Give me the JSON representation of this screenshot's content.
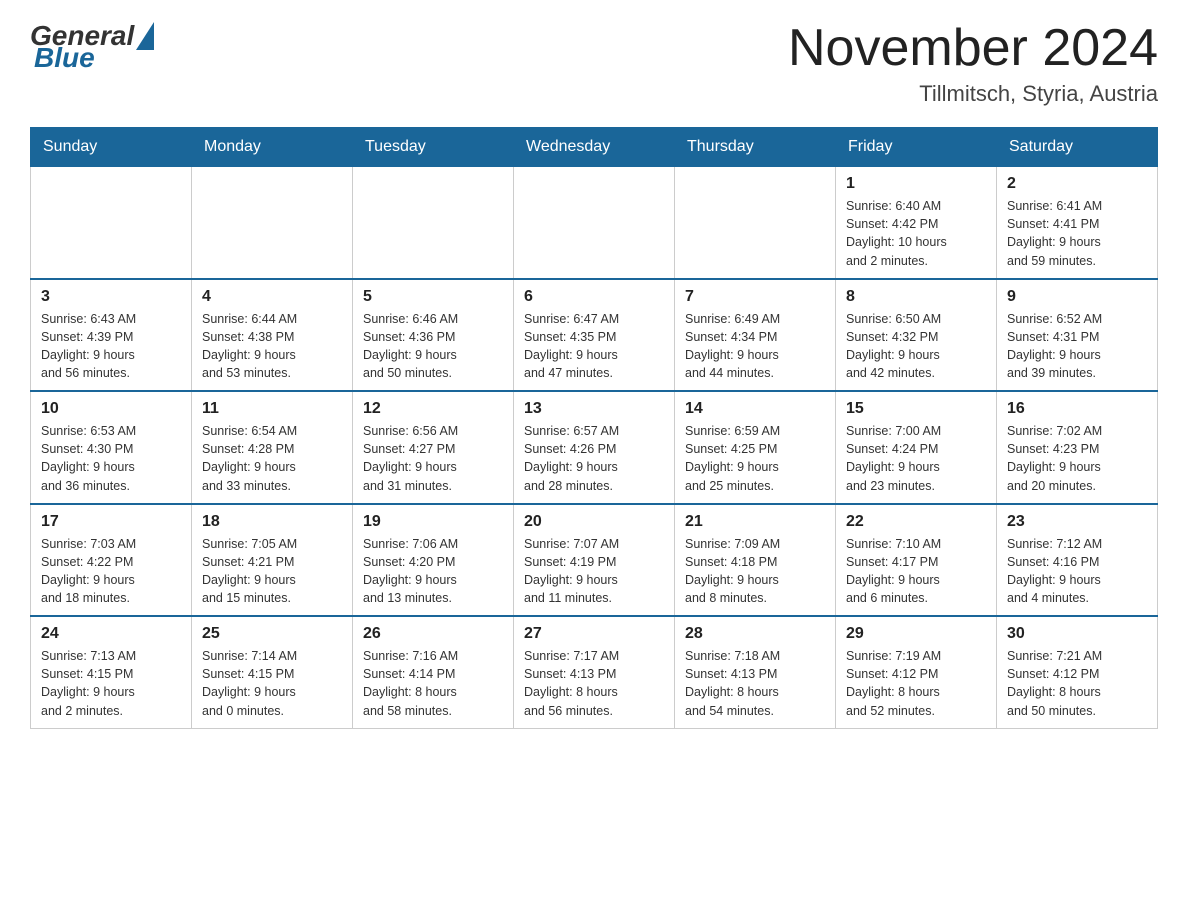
{
  "header": {
    "logo_general": "General",
    "logo_blue": "Blue",
    "month_title": "November 2024",
    "location": "Tillmitsch, Styria, Austria"
  },
  "weekdays": [
    "Sunday",
    "Monday",
    "Tuesday",
    "Wednesday",
    "Thursday",
    "Friday",
    "Saturday"
  ],
  "weeks": [
    [
      {
        "day": "",
        "info": ""
      },
      {
        "day": "",
        "info": ""
      },
      {
        "day": "",
        "info": ""
      },
      {
        "day": "",
        "info": ""
      },
      {
        "day": "",
        "info": ""
      },
      {
        "day": "1",
        "info": "Sunrise: 6:40 AM\nSunset: 4:42 PM\nDaylight: 10 hours\nand 2 minutes."
      },
      {
        "day": "2",
        "info": "Sunrise: 6:41 AM\nSunset: 4:41 PM\nDaylight: 9 hours\nand 59 minutes."
      }
    ],
    [
      {
        "day": "3",
        "info": "Sunrise: 6:43 AM\nSunset: 4:39 PM\nDaylight: 9 hours\nand 56 minutes."
      },
      {
        "day": "4",
        "info": "Sunrise: 6:44 AM\nSunset: 4:38 PM\nDaylight: 9 hours\nand 53 minutes."
      },
      {
        "day": "5",
        "info": "Sunrise: 6:46 AM\nSunset: 4:36 PM\nDaylight: 9 hours\nand 50 minutes."
      },
      {
        "day": "6",
        "info": "Sunrise: 6:47 AM\nSunset: 4:35 PM\nDaylight: 9 hours\nand 47 minutes."
      },
      {
        "day": "7",
        "info": "Sunrise: 6:49 AM\nSunset: 4:34 PM\nDaylight: 9 hours\nand 44 minutes."
      },
      {
        "day": "8",
        "info": "Sunrise: 6:50 AM\nSunset: 4:32 PM\nDaylight: 9 hours\nand 42 minutes."
      },
      {
        "day": "9",
        "info": "Sunrise: 6:52 AM\nSunset: 4:31 PM\nDaylight: 9 hours\nand 39 minutes."
      }
    ],
    [
      {
        "day": "10",
        "info": "Sunrise: 6:53 AM\nSunset: 4:30 PM\nDaylight: 9 hours\nand 36 minutes."
      },
      {
        "day": "11",
        "info": "Sunrise: 6:54 AM\nSunset: 4:28 PM\nDaylight: 9 hours\nand 33 minutes."
      },
      {
        "day": "12",
        "info": "Sunrise: 6:56 AM\nSunset: 4:27 PM\nDaylight: 9 hours\nand 31 minutes."
      },
      {
        "day": "13",
        "info": "Sunrise: 6:57 AM\nSunset: 4:26 PM\nDaylight: 9 hours\nand 28 minutes."
      },
      {
        "day": "14",
        "info": "Sunrise: 6:59 AM\nSunset: 4:25 PM\nDaylight: 9 hours\nand 25 minutes."
      },
      {
        "day": "15",
        "info": "Sunrise: 7:00 AM\nSunset: 4:24 PM\nDaylight: 9 hours\nand 23 minutes."
      },
      {
        "day": "16",
        "info": "Sunrise: 7:02 AM\nSunset: 4:23 PM\nDaylight: 9 hours\nand 20 minutes."
      }
    ],
    [
      {
        "day": "17",
        "info": "Sunrise: 7:03 AM\nSunset: 4:22 PM\nDaylight: 9 hours\nand 18 minutes."
      },
      {
        "day": "18",
        "info": "Sunrise: 7:05 AM\nSunset: 4:21 PM\nDaylight: 9 hours\nand 15 minutes."
      },
      {
        "day": "19",
        "info": "Sunrise: 7:06 AM\nSunset: 4:20 PM\nDaylight: 9 hours\nand 13 minutes."
      },
      {
        "day": "20",
        "info": "Sunrise: 7:07 AM\nSunset: 4:19 PM\nDaylight: 9 hours\nand 11 minutes."
      },
      {
        "day": "21",
        "info": "Sunrise: 7:09 AM\nSunset: 4:18 PM\nDaylight: 9 hours\nand 8 minutes."
      },
      {
        "day": "22",
        "info": "Sunrise: 7:10 AM\nSunset: 4:17 PM\nDaylight: 9 hours\nand 6 minutes."
      },
      {
        "day": "23",
        "info": "Sunrise: 7:12 AM\nSunset: 4:16 PM\nDaylight: 9 hours\nand 4 minutes."
      }
    ],
    [
      {
        "day": "24",
        "info": "Sunrise: 7:13 AM\nSunset: 4:15 PM\nDaylight: 9 hours\nand 2 minutes."
      },
      {
        "day": "25",
        "info": "Sunrise: 7:14 AM\nSunset: 4:15 PM\nDaylight: 9 hours\nand 0 minutes."
      },
      {
        "day": "26",
        "info": "Sunrise: 7:16 AM\nSunset: 4:14 PM\nDaylight: 8 hours\nand 58 minutes."
      },
      {
        "day": "27",
        "info": "Sunrise: 7:17 AM\nSunset: 4:13 PM\nDaylight: 8 hours\nand 56 minutes."
      },
      {
        "day": "28",
        "info": "Sunrise: 7:18 AM\nSunset: 4:13 PM\nDaylight: 8 hours\nand 54 minutes."
      },
      {
        "day": "29",
        "info": "Sunrise: 7:19 AM\nSunset: 4:12 PM\nDaylight: 8 hours\nand 52 minutes."
      },
      {
        "day": "30",
        "info": "Sunrise: 7:21 AM\nSunset: 4:12 PM\nDaylight: 8 hours\nand 50 minutes."
      }
    ]
  ]
}
